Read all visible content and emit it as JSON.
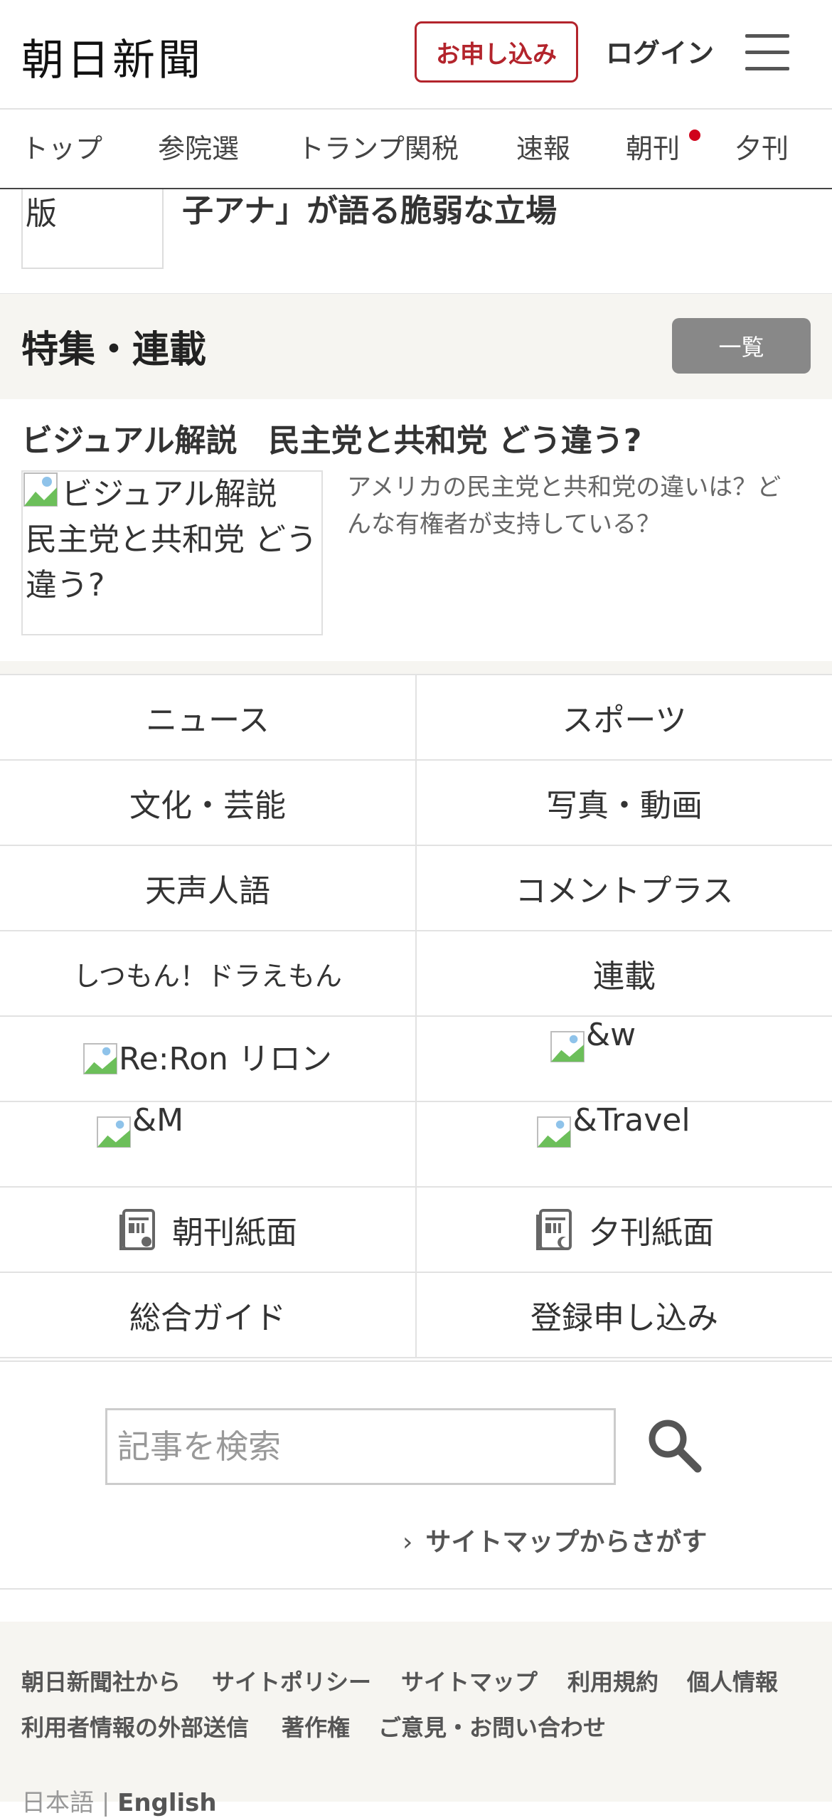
{
  "header": {
    "logo": "朝日新聞",
    "apply_label": "お申し込み",
    "login_label": "ログイン"
  },
  "nav": {
    "items": [
      "トップ",
      "参院選",
      "トランプ関税",
      "速報",
      "朝刊",
      "夕刊"
    ]
  },
  "article_remnant": {
    "thumb_alt": "版",
    "title": "子アナ」が語る脆弱な立場"
  },
  "feature": {
    "section_title": "特集・連載",
    "list_button": "一覧",
    "card": {
      "title": "ビジュアル解説　民主党と共和党 どう違う?",
      "image_alt": "ビジュアル解説 民主党と共和党 どう違う?",
      "description": "アメリカの民主党と共和党の違いは？どんな有権者が支持している？"
    }
  },
  "categories": {
    "news": "ニュース",
    "sports": "スポーツ",
    "culture": "文化・芸能",
    "photo_video": "写真・動画",
    "tensei": "天声人語",
    "comment_plus": "コメントプラス",
    "doraemon": "しつもん！ドラえもん",
    "series": "連載",
    "reron": "Re:Ron リロン",
    "and_w": "&w",
    "and_m": "&M",
    "and_travel": "&Travel",
    "morning_paper": "朝刊紙面",
    "evening_paper": "夕刊紙面",
    "guide": "総合ガイド",
    "register": "登録申し込み"
  },
  "search": {
    "placeholder": "記事を検索",
    "sitemap_link": "サイトマップからさがす"
  },
  "footer": {
    "links_row1": [
      "朝日新聞社から",
      "サイトポリシー",
      "サイトマップ",
      "利用規約",
      "個人情報"
    ],
    "links_row2": [
      "利用者情報の外部送信",
      "著作権",
      "ご意見・お問い合わせ"
    ],
    "lang_ja": "日本語",
    "lang_sep": "|",
    "lang_en": "English"
  },
  "colors": {
    "brand_red": "#b3242c",
    "notification_dot": "#d0021b",
    "section_bg": "#f6f5f1"
  }
}
